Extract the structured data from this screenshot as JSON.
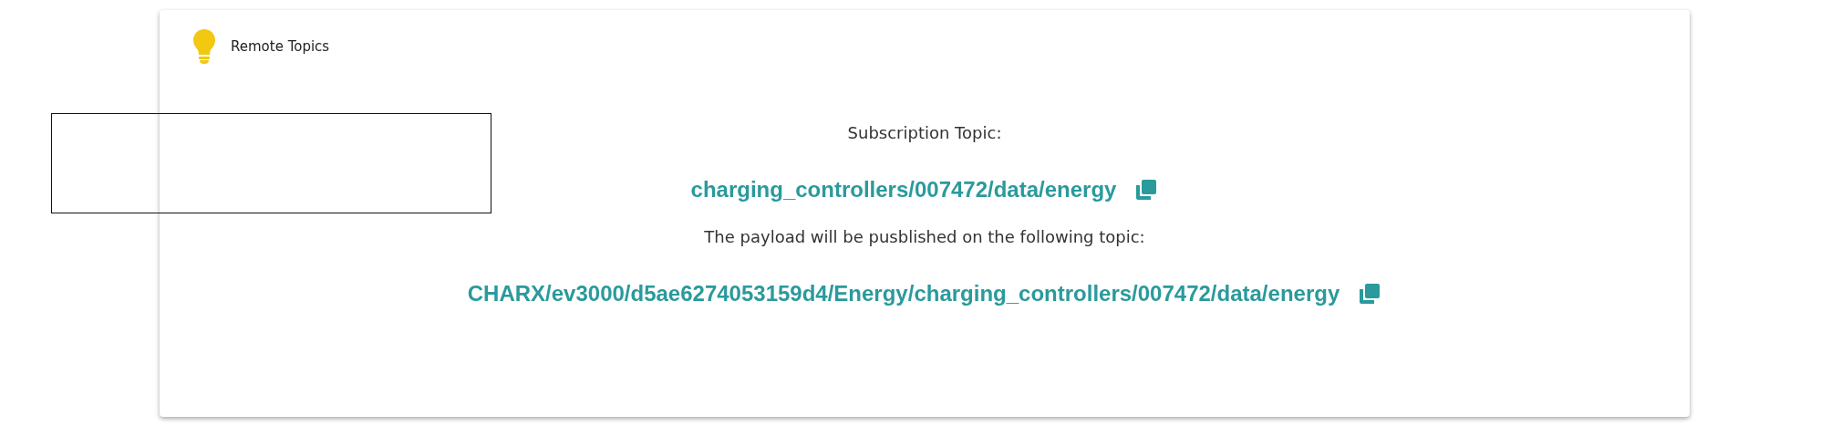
{
  "card": {
    "title": "Remote Topics"
  },
  "topics": [
    {
      "label": "Subscription Topic:",
      "value": "charging_controllers/007472/data/energy"
    },
    {
      "label": "The payload will be pusblished on the following topic:",
      "value": "CHARX/ev3000/d5ae6274053159d4/Energy/charging_controllers/007472/data/energy"
    }
  ]
}
